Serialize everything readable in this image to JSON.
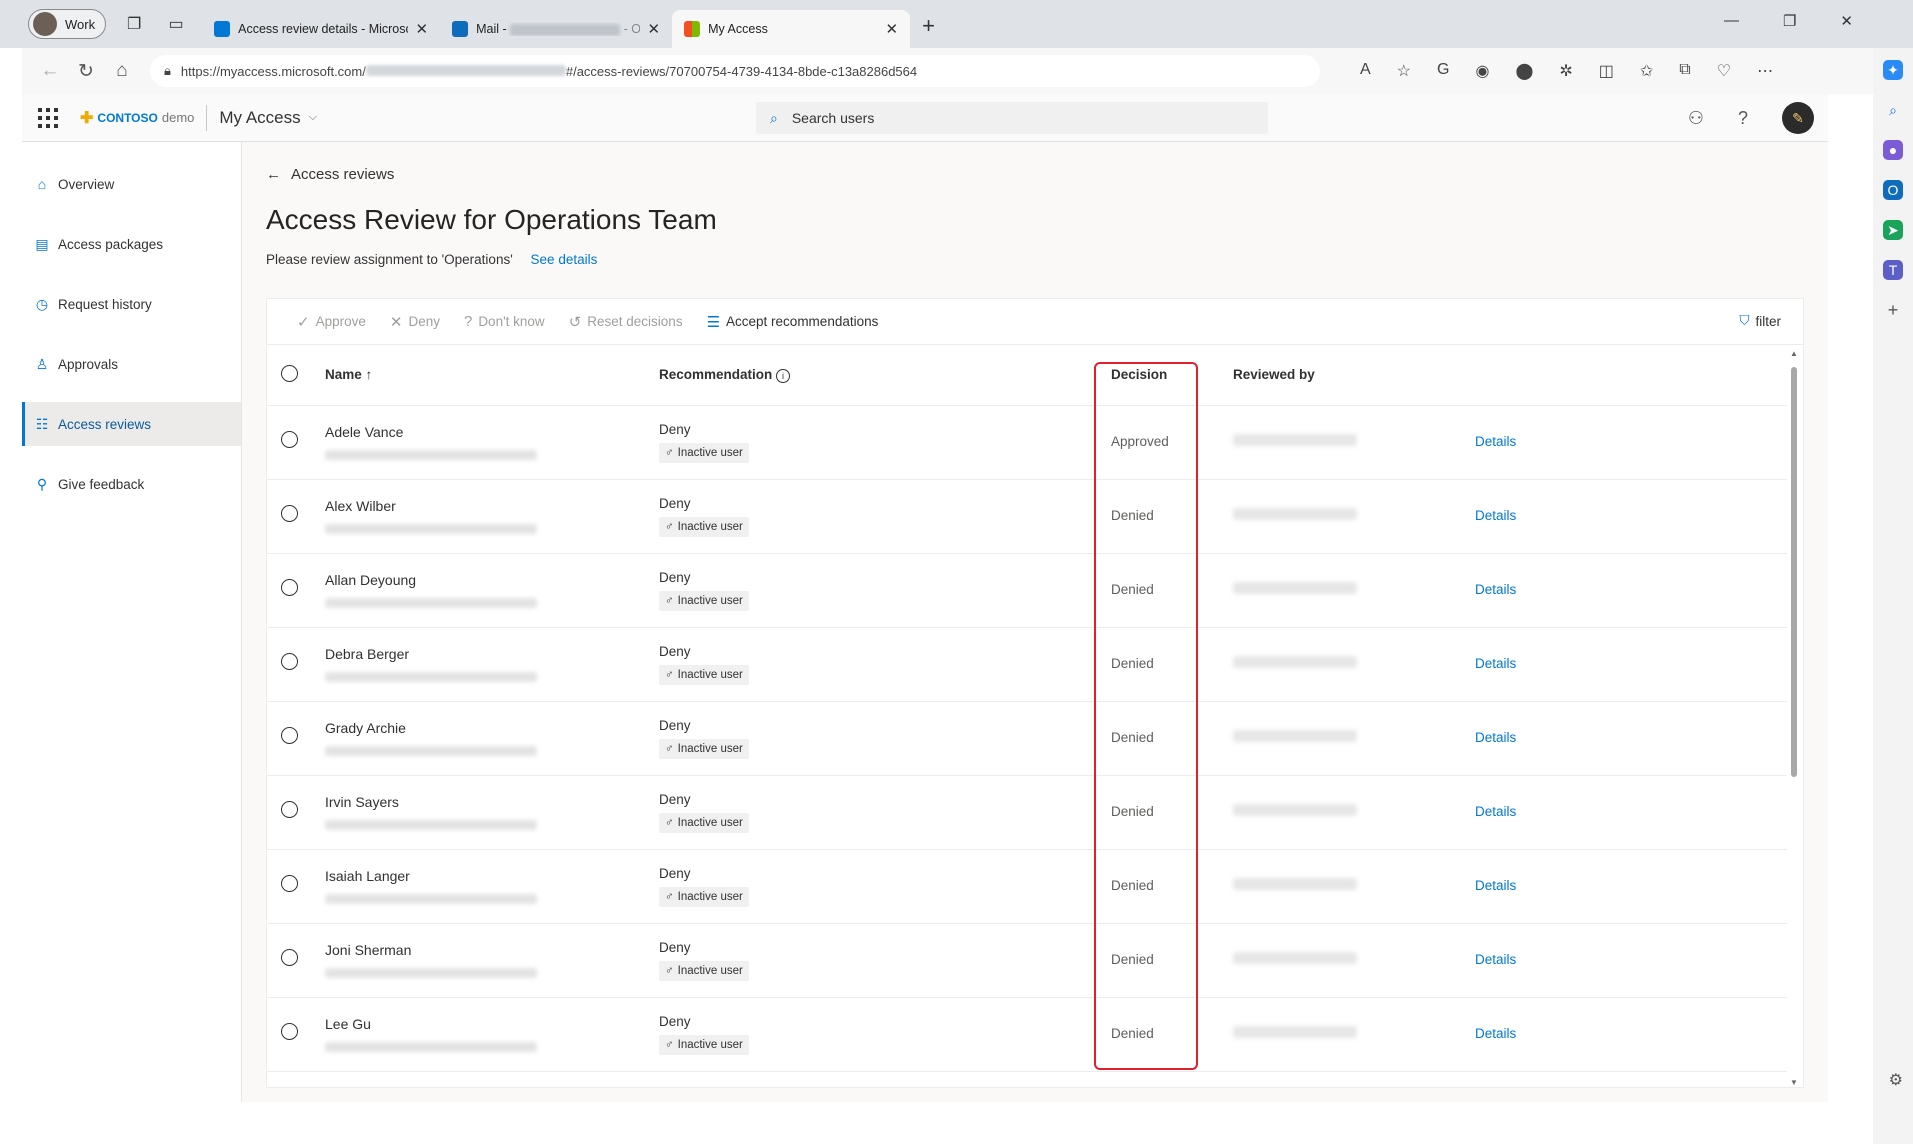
{
  "browser": {
    "profile": "Work",
    "tabs": [
      {
        "title": "Access review details - Microsoft",
        "color": "#0078d4"
      },
      {
        "title": "Mail -",
        "title_suffix": "- Outl",
        "color": "#0f6cbd"
      },
      {
        "title": "My Access",
        "color": "#f25022"
      }
    ],
    "url_prefix": "https://myaccess.microsoft.com/",
    "url_suffix": "#/access-reviews/70700754-4739-4134-8bde-c13a8286d564"
  },
  "app": {
    "brand_contoso": "CONTOSO",
    "brand_demo": "demo",
    "name": "My Access",
    "search_placeholder": "Search users"
  },
  "nav": [
    {
      "label": "Overview",
      "icon": "home-icon"
    },
    {
      "label": "Access packages",
      "icon": "package-icon"
    },
    {
      "label": "Request history",
      "icon": "history-icon"
    },
    {
      "label": "Approvals",
      "icon": "person-icon"
    },
    {
      "label": "Access reviews",
      "icon": "review-list-icon",
      "active": true
    },
    {
      "label": "Give feedback",
      "icon": "feedback-icon"
    }
  ],
  "page": {
    "back_label": "Access reviews",
    "title": "Access Review for Operations Team",
    "subtitle": "Please review assignment to 'Operations'",
    "see_details": "See details"
  },
  "commands": {
    "approve": "Approve",
    "deny": "Deny",
    "dont_know": "Don't know",
    "reset": "Reset decisions",
    "accept": "Accept recommendations",
    "filter": "filter"
  },
  "table": {
    "headers": {
      "name": "Name",
      "recommendation": "Recommendation",
      "decision": "Decision",
      "reviewed_by": "Reviewed by"
    },
    "rows": [
      {
        "name": "Adele Vance",
        "recommendation": "Deny",
        "tag": "Inactive user",
        "decision": "Approved",
        "details": "Details"
      },
      {
        "name": "Alex Wilber",
        "recommendation": "Deny",
        "tag": "Inactive user",
        "decision": "Denied",
        "details": "Details"
      },
      {
        "name": "Allan Deyoung",
        "recommendation": "Deny",
        "tag": "Inactive user",
        "decision": "Denied",
        "details": "Details"
      },
      {
        "name": "Debra Berger",
        "recommendation": "Deny",
        "tag": "Inactive user",
        "decision": "Denied",
        "details": "Details"
      },
      {
        "name": "Grady Archie",
        "recommendation": "Deny",
        "tag": "Inactive user",
        "decision": "Denied",
        "details": "Details"
      },
      {
        "name": "Irvin Sayers",
        "recommendation": "Deny",
        "tag": "Inactive user",
        "decision": "Denied",
        "details": "Details"
      },
      {
        "name": "Isaiah Langer",
        "recommendation": "Deny",
        "tag": "Inactive user",
        "decision": "Denied",
        "details": "Details"
      },
      {
        "name": "Joni Sherman",
        "recommendation": "Deny",
        "tag": "Inactive user",
        "decision": "Denied",
        "details": "Details"
      },
      {
        "name": "Lee Gu",
        "recommendation": "Deny",
        "tag": "Inactive user",
        "decision": "Denied",
        "details": "Details"
      }
    ]
  },
  "colors": {
    "accent": "#0078d4",
    "highlight": "#e0202c"
  }
}
